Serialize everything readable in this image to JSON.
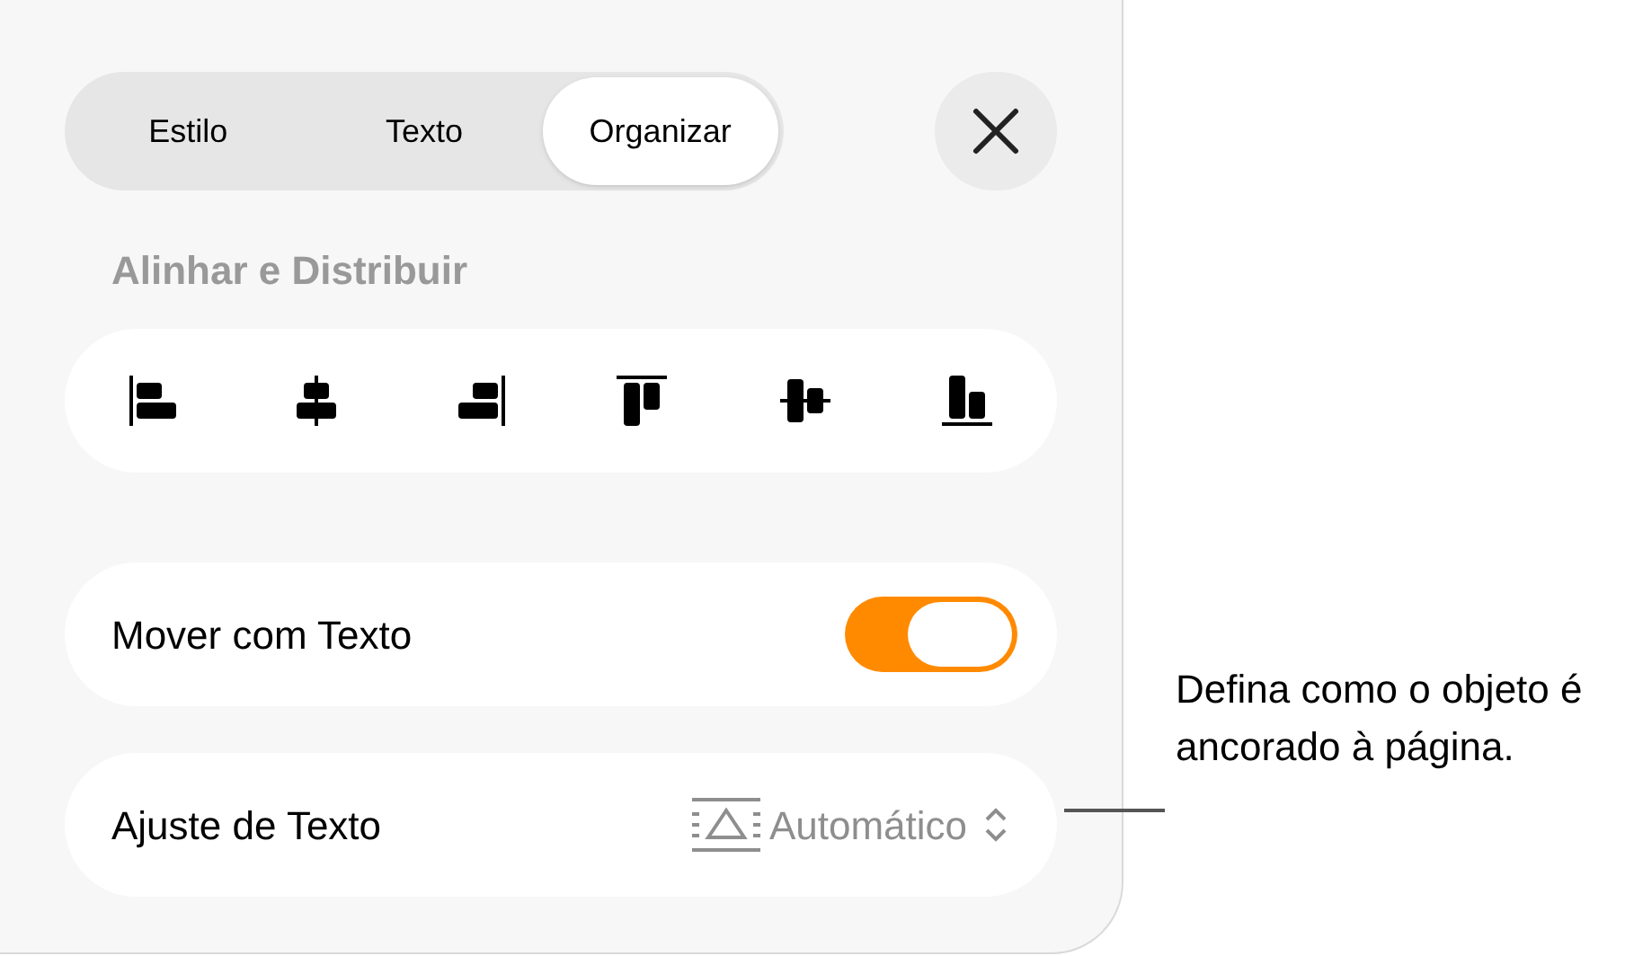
{
  "tabs": [
    {
      "label": "Estilo",
      "selected": false
    },
    {
      "label": "Texto",
      "selected": false
    },
    {
      "label": "Organizar",
      "selected": true
    }
  ],
  "section_title": "Alinhar e Distribuir",
  "align_buttons": [
    {
      "kind": "left"
    },
    {
      "kind": "center"
    },
    {
      "kind": "right"
    },
    {
      "kind": "top"
    },
    {
      "kind": "middle"
    },
    {
      "kind": "bottom"
    }
  ],
  "move_with_text": {
    "label": "Mover com Texto",
    "on": true
  },
  "text_wrap": {
    "label": "Ajuste de Texto",
    "value": "Automático"
  },
  "callout": "Defina como o objeto é ancorado à página."
}
